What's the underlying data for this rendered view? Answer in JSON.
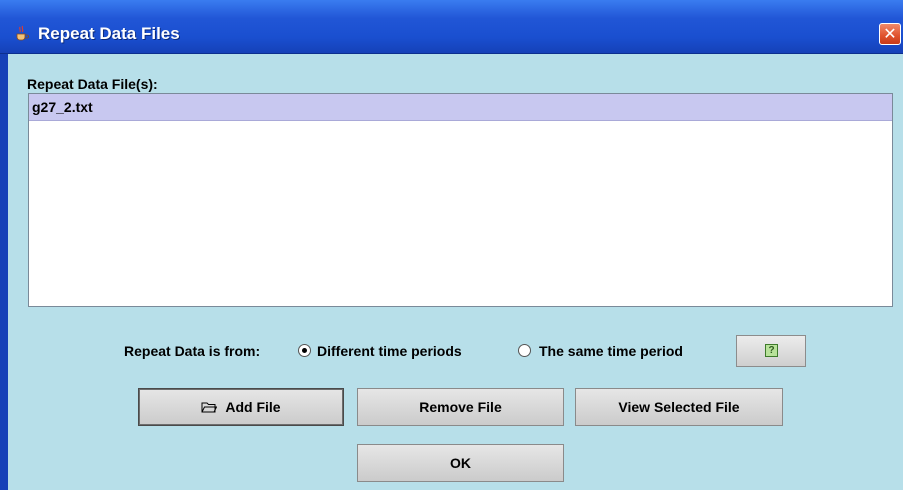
{
  "window": {
    "title": "Repeat Data Files",
    "close_glyph": "✕"
  },
  "list": {
    "label": "Repeat Data File(s):",
    "items": [
      "g27_2.txt"
    ]
  },
  "source": {
    "prompt": "Repeat Data is from:",
    "options": [
      {
        "label": "Different time periods",
        "selected": true
      },
      {
        "label": "The same time period",
        "selected": false
      }
    ]
  },
  "buttons": {
    "help_glyph": "?",
    "add": "Add File",
    "remove": "Remove File",
    "view": "View Selected File",
    "ok": "OK"
  },
  "icons": {
    "app": "java-cup-icon",
    "help": "help-icon",
    "folder": "folder-open-icon"
  }
}
